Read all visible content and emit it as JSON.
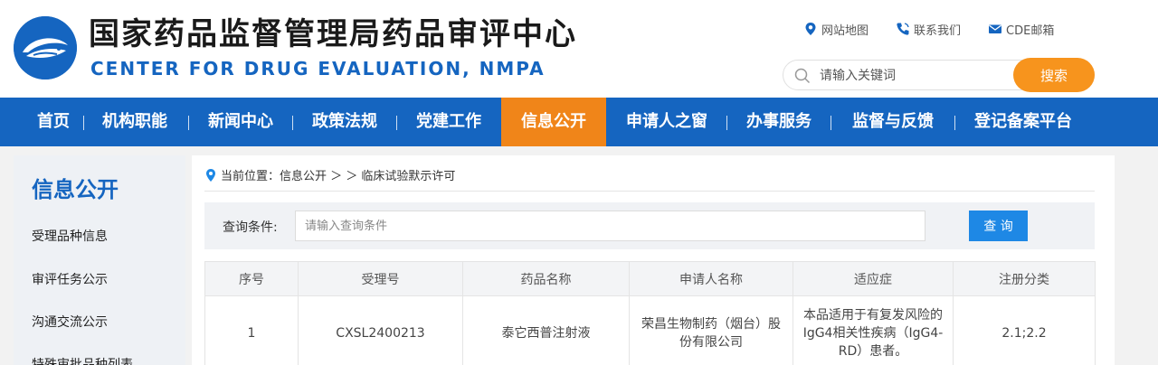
{
  "header": {
    "title_cn": "国家药品监督管理局药品审评中心",
    "title_en": "CENTER FOR DRUG EVALUATION, NMPA",
    "logo_icon": "cde-logo-icon",
    "links": [
      {
        "label": "网站地图",
        "icon": "location-pin-icon"
      },
      {
        "label": "联系我们",
        "icon": "phone-icon"
      },
      {
        "label": "CDE邮箱",
        "icon": "mail-icon"
      }
    ],
    "search": {
      "placeholder": "请输入关键词",
      "button": "搜索"
    }
  },
  "nav": {
    "items": [
      "首页",
      "机构职能",
      "新闻中心",
      "政策法规",
      "党建工作",
      "信息公开",
      "申请人之窗",
      "办事服务",
      "监督与反馈",
      "登记备案平台"
    ],
    "active": "信息公开"
  },
  "sidebar": {
    "title": "信息公开",
    "items": [
      "受理品种信息",
      "审评任务公示",
      "沟通交流公示",
      "特殊审批品种列表"
    ]
  },
  "breadcrumb": {
    "text": "当前位置：信息公开 ＞ ＞ 临床试验默示许可"
  },
  "query": {
    "label": "查询条件:",
    "placeholder": "请输入查询条件",
    "button": "查 询"
  },
  "table": {
    "headers": [
      "序号",
      "受理号",
      "药品名称",
      "申请人名称",
      "适应症",
      "注册分类"
    ],
    "rows": [
      [
        "1",
        "CXSL2400213",
        "泰它西普注射液",
        "荣昌生物制药（烟台）股份有限公司",
        "本品适用于有复发风险的IgG4相关性疾病（IgG4-RD）患者。",
        "2.1;2.2"
      ]
    ]
  },
  "colors": {
    "brand_blue": "#1565c0",
    "active_orange": "#f08519",
    "search_orange": "#f7941d",
    "query_blue": "#1e88e5"
  }
}
